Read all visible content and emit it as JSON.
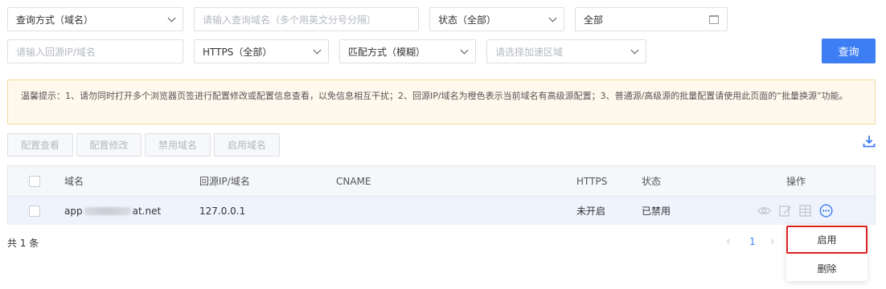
{
  "filters": {
    "query_mode": "查询方式（域名）",
    "domain_placeholder": "请输入查询域名（多个用英文分号分隔）",
    "status": "状态（全部）",
    "date_range": "全部",
    "origin_placeholder": "请输入回源IP/域名",
    "https": "HTTPS（全部）",
    "match_mode": "匹配方式（模糊）",
    "region_placeholder": "请选择加速区域",
    "query_button": "查询"
  },
  "notice": {
    "text": "温馨提示：1、请勿同时打开多个浏览器页签进行配置修改或配置信息查看，以免信息相互干扰；2、回源IP/域名为橙色表示当前域名有高级源配置；3、普通源/高级源的批量配置请使用此页面的“批量换源”功能。"
  },
  "actions": {
    "view_config": "配置查看",
    "edit_config": "配置修改",
    "disable_domain": "禁用域名",
    "enable_domain": "启用域名"
  },
  "table": {
    "headers": {
      "domain": "域名",
      "origin": "回源IP/域名",
      "cname": "CNAME",
      "https": "HTTPS",
      "status": "状态",
      "operation": "操作"
    },
    "rows": [
      {
        "domain_prefix": "app",
        "domain_suffix": "at.net",
        "origin": "127.0.0.1",
        "cname": "",
        "https": "未开启",
        "status": "已禁用"
      }
    ]
  },
  "pagination": {
    "total": "共 1 条",
    "current_page": "1"
  },
  "more_menu": {
    "enable": "启用",
    "delete": "删除"
  },
  "colors": {
    "primary": "#3d7ef5",
    "highlight_border": "#e02020",
    "notice_bg": "#fff8ec"
  }
}
